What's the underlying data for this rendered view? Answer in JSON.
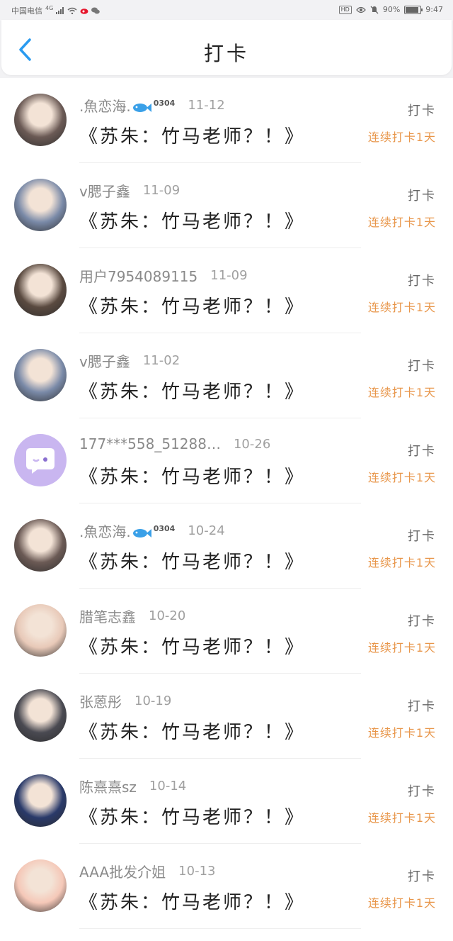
{
  "status_bar": {
    "carrier": "中国电信",
    "network": "4G",
    "battery_text": "90%",
    "battery_level": 0.9,
    "time": "9:47",
    "hd": "HD"
  },
  "header": {
    "title": "打卡"
  },
  "entries": [
    {
      "username": ".魚恋海.",
      "badge": "0304",
      "date": "11-12",
      "book": "《苏朱：竹马老师？！》",
      "action": "打卡",
      "streak": "连续打卡1天",
      "avatar_color": "#6b5a55"
    },
    {
      "username": "v腮子鑫",
      "date": "11-09",
      "book": "《苏朱：竹马老师？！》",
      "action": "打卡",
      "streak": "连续打卡1天",
      "avatar_color": "#7a8aa8"
    },
    {
      "username": "用户7954089115",
      "date": "11-09",
      "book": "《苏朱：竹马老师？！》",
      "action": "打卡",
      "streak": "连续打卡1天",
      "avatar_color": "#5a4a40"
    },
    {
      "username": "v腮子鑫",
      "date": "11-02",
      "book": "《苏朱：竹马老师？！》",
      "action": "打卡",
      "streak": "连续打卡1天",
      "avatar_color": "#7a8aa8"
    },
    {
      "username": "177***558_51288…",
      "date": "10-26",
      "book": "《苏朱：竹马老师？！》",
      "action": "打卡",
      "streak": "连续打卡1天",
      "avatar_color": "#c9b6f0"
    },
    {
      "username": ".魚恋海.",
      "badge": "0304",
      "date": "10-24",
      "book": "《苏朱：竹马老师？！》",
      "action": "打卡",
      "streak": "连续打卡1天",
      "avatar_color": "#6b5a55"
    },
    {
      "username": "腊笔志鑫",
      "date": "10-20",
      "book": "《苏朱：竹马老师？！》",
      "action": "打卡",
      "streak": "连续打卡1天",
      "avatar_color": "#e8c9b8"
    },
    {
      "username": "张蒽彤",
      "date": "10-19",
      "book": "《苏朱：竹马老师？！》",
      "action": "打卡",
      "streak": "连续打卡1天",
      "avatar_color": "#4a4a52"
    },
    {
      "username": "陈熹熹sz",
      "date": "10-14",
      "book": "《苏朱：竹马老师？！》",
      "action": "打卡",
      "streak": "连续打卡1天",
      "avatar_color": "#2a3a6a"
    },
    {
      "username": "AAA批发介姐",
      "date": "10-13",
      "book": "《苏朱：竹马老师？！》",
      "action": "打卡",
      "streak": "连续打卡1天",
      "avatar_color": "#f5c8b8"
    }
  ]
}
